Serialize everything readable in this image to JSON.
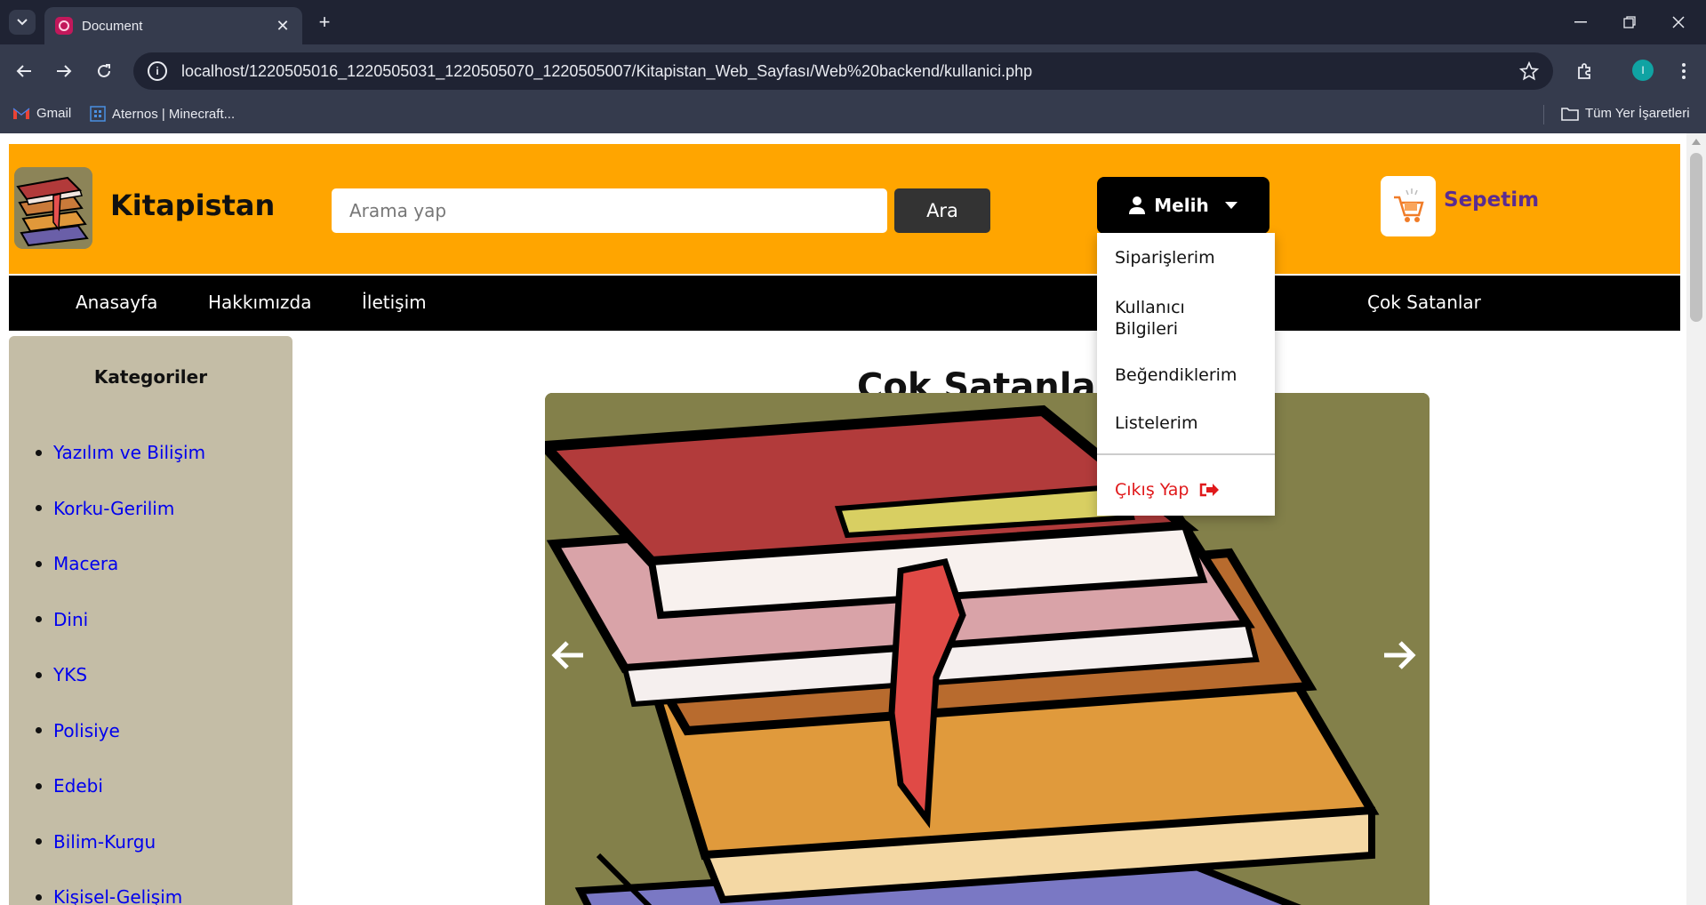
{
  "browser": {
    "tab_title": "Document",
    "url": "localhost/1220505016_1220505031_1220505070_1220505007/Kitapistan_Web_Sayfası/Web%20backend/kullanici.php",
    "profile_initial": "I",
    "bookmarks": [
      {
        "label": "Gmail",
        "icon": "gmail-icon"
      },
      {
        "label": "Aternos | Minecraft..."
      }
    ],
    "all_bookmarks_label": "Tüm Yer İşaretleri"
  },
  "header": {
    "brand": "Kitapistan",
    "search_placeholder": "Arama yap",
    "search_button": "Ara",
    "user_name": "Melih",
    "cart_label": "Sepetim"
  },
  "nav": {
    "items": [
      "Anasayfa",
      "Hakkımızda",
      "İletişim"
    ],
    "right_item": "Çok Satanlar"
  },
  "sidebar": {
    "title": "Kategoriler",
    "categories": [
      "Yazılım ve Bilişim",
      "Korku-Gerilim",
      "Macera",
      "Dini",
      "YKS",
      "Polisiye",
      "Edebi",
      "Bilim-Kurgu",
      "Kişisel-Gelişim"
    ]
  },
  "main": {
    "section_title": "Çok Satanlar"
  },
  "user_menu": {
    "items": [
      "Siparişlerim",
      "Kullanıcı Bilgileri",
      "Beğendiklerim",
      "Listelerim"
    ],
    "logout": "Çıkış Yap"
  },
  "colors": {
    "header_bg": "#ffa500",
    "nav_bg": "#000000",
    "sidebar_bg": "#c4bda6",
    "cart_text": "#5a2c91",
    "link": "#0000ee",
    "logout": "#e0191b"
  }
}
